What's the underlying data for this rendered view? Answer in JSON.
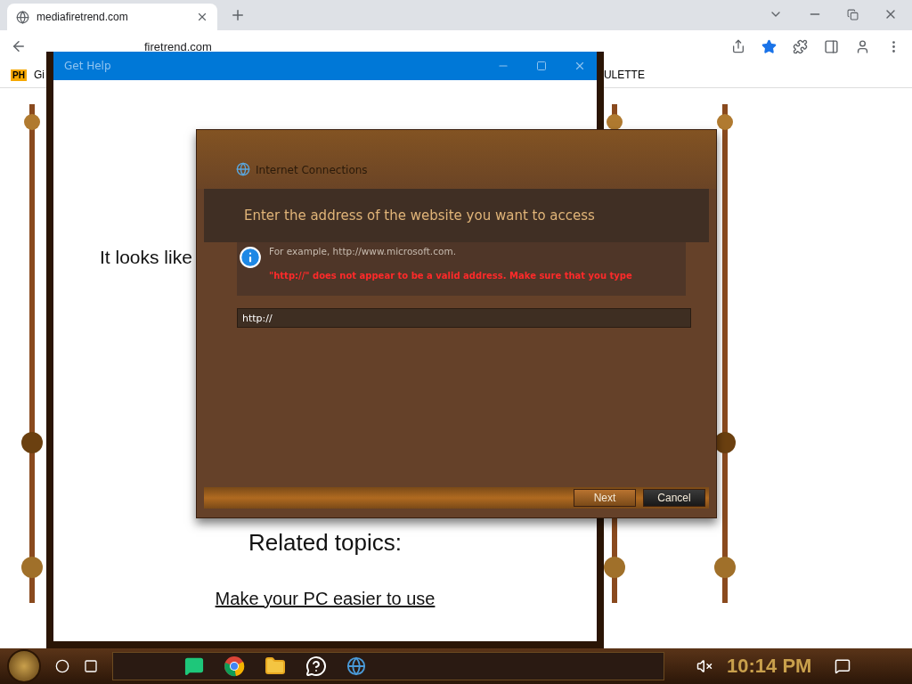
{
  "browser": {
    "tab": {
      "title": "mediafiretrend.com"
    },
    "address": "firetrend.com",
    "bookmarks": [
      {
        "label": "Gi",
        "badge": "PH"
      },
      {
        "label": "ULETTE"
      }
    ]
  },
  "get_help": {
    "title": "Get Help",
    "message": "It looks like",
    "related_heading": "Related topics:",
    "links": [
      "Make your PC easier to use"
    ]
  },
  "dialog": {
    "title": "Internet Connections",
    "heading": "Enter the address of the website you want to access",
    "hint": "For example, http://www.microsoft.com.",
    "error": "\"http://\" does not appear to be a valid address. Make sure that you type",
    "address_value": "http://",
    "buttons": [
      {
        "label": "Next",
        "kind": "primary"
      },
      {
        "label": "Cancel",
        "kind": "secondary"
      }
    ]
  },
  "taskbar": {
    "apps": [
      {
        "kind": "chat"
      },
      {
        "kind": "chrome"
      },
      {
        "kind": "folder"
      },
      {
        "kind": "help"
      },
      {
        "kind": "network"
      }
    ],
    "clock": "10:14 PM"
  }
}
